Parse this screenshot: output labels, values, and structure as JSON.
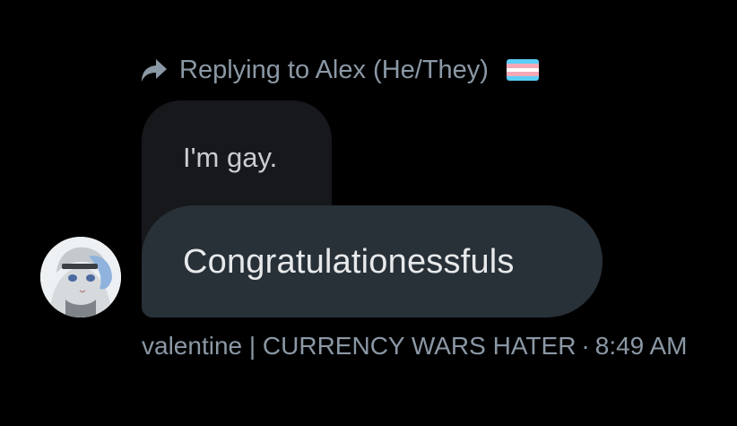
{
  "reply_context": {
    "prefix": "Replying to",
    "name": "Alex (He/They)",
    "icon": "reply-arrow-icon",
    "flag_icon": "transgender-flag-icon",
    "flag_colors": [
      "#5BCEFA",
      "#F5A9B8",
      "#FFFFFF",
      "#F5A9B8",
      "#5BCEFA"
    ]
  },
  "quoted_message": {
    "text": "I'm gay."
  },
  "message": {
    "text": "Congratulationessfuls"
  },
  "sender": {
    "name": "valentine | CURRENCY WARS HATER",
    "separator": "·",
    "time": "8:49 AM",
    "avatar": "anime-character-avatar"
  },
  "colors": {
    "background": "#000000",
    "quoted_bubble": "#16181c",
    "message_bubble": "#283038",
    "muted_text": "#8b98a5",
    "primary_text": "#e7e9ea"
  }
}
